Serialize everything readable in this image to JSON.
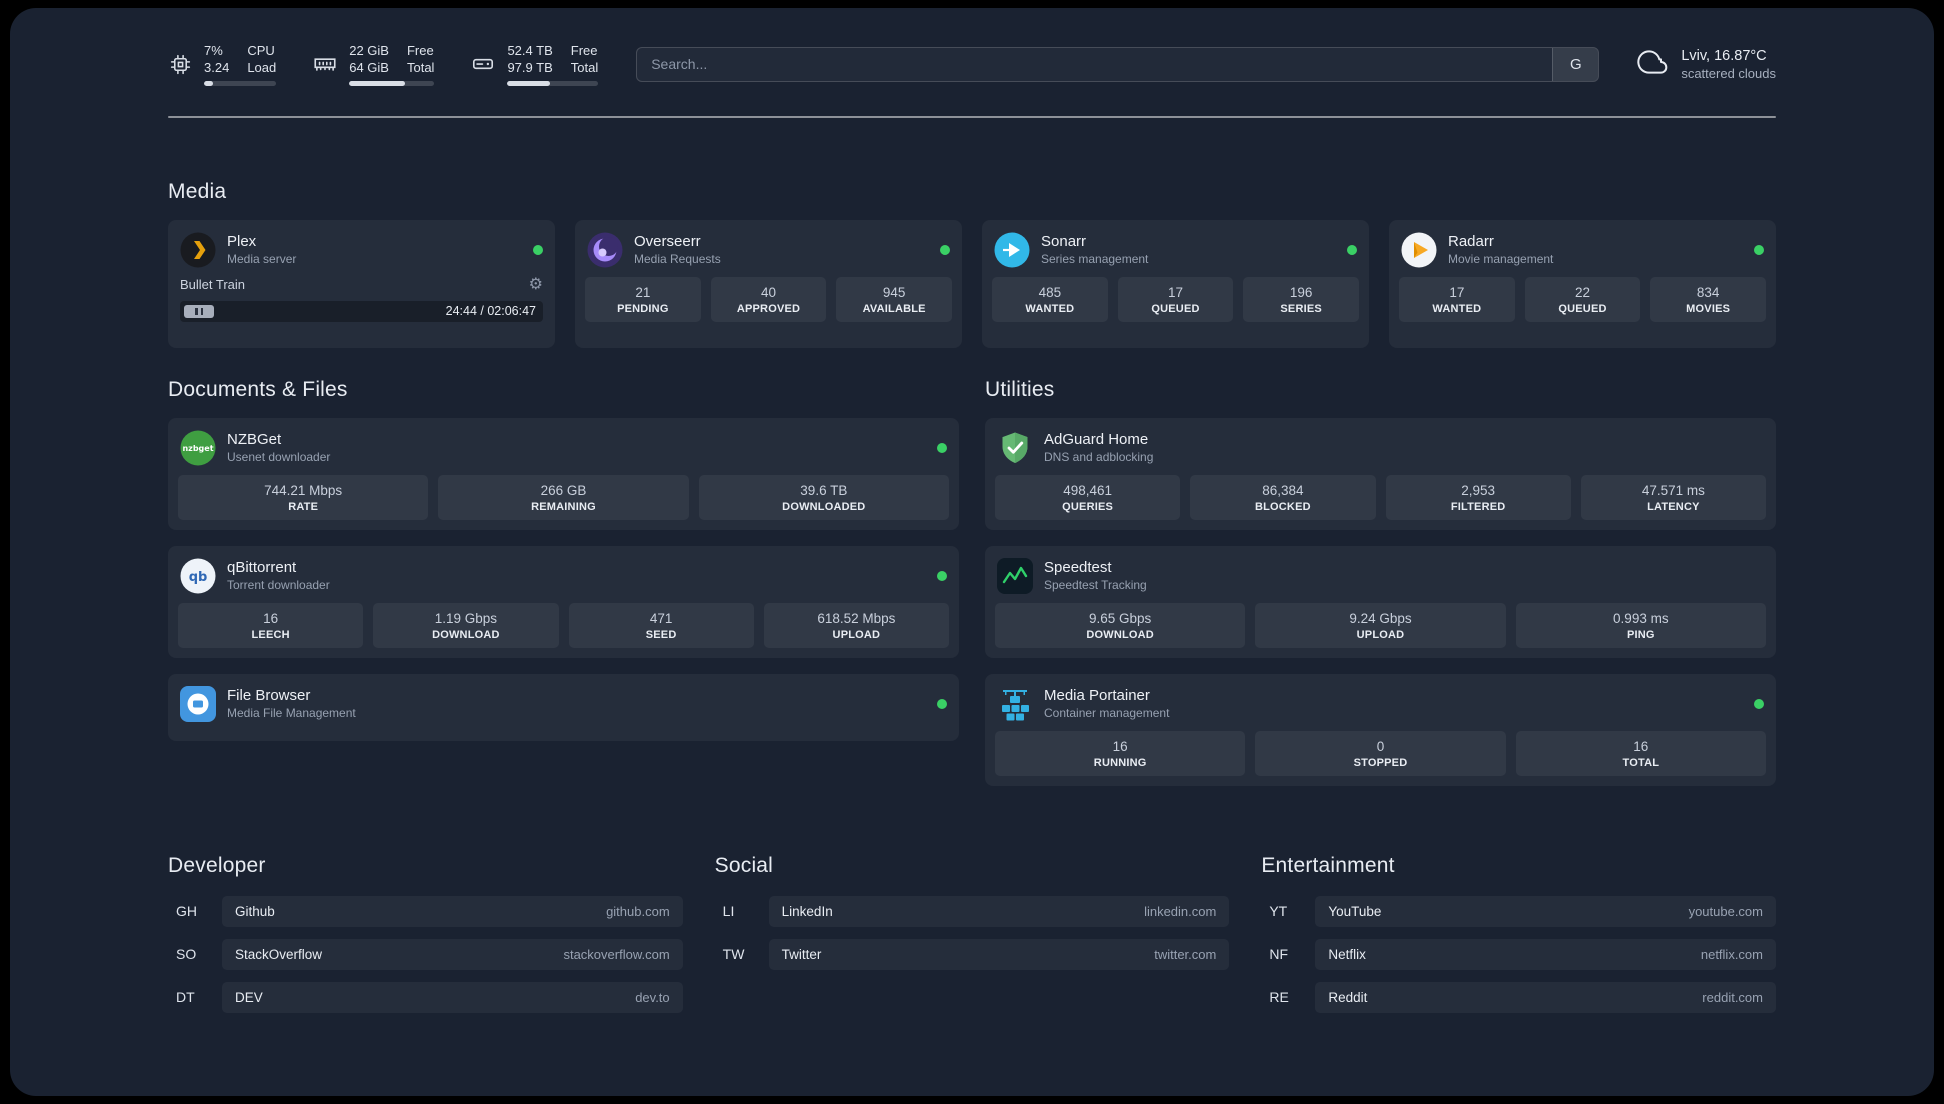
{
  "colors": {
    "background": "#1a2231",
    "card": "rgba(255,255,255,0.05)",
    "status_online": "#3ad065"
  },
  "topbar": {
    "resources": [
      {
        "id": "cpu",
        "rows_left": [
          "7%",
          "3.24"
        ],
        "rows_right": [
          "CPU",
          "Load"
        ],
        "bar_percent": 12
      },
      {
        "id": "memory",
        "rows_left": [
          "22 GiB",
          "64 GiB"
        ],
        "rows_right": [
          "Free",
          "Total"
        ],
        "bar_percent": 66
      },
      {
        "id": "disk",
        "rows_left": [
          "52.4 TB",
          "97.9 TB"
        ],
        "rows_right": [
          "Free",
          "Total"
        ],
        "bar_percent": 47
      }
    ],
    "search": {
      "placeholder": "Search...",
      "provider_button": "G"
    },
    "weather": {
      "location": "Lviv, 16.87°C",
      "condition": "scattered clouds"
    }
  },
  "sections": {
    "media": {
      "title": "Media",
      "cards": [
        {
          "name": "Plex",
          "subtitle": "Media server",
          "icon": "plex",
          "online": true,
          "player": {
            "track": "Bullet Train",
            "time": "24:44 / 02:06:47"
          }
        },
        {
          "name": "Overseerr",
          "subtitle": "Media Requests",
          "icon": "overseerr",
          "online": true,
          "stats": [
            {
              "value": "21",
              "label": "PENDING"
            },
            {
              "value": "40",
              "label": "APPROVED"
            },
            {
              "value": "945",
              "label": "AVAILABLE"
            }
          ]
        },
        {
          "name": "Sonarr",
          "subtitle": "Series management",
          "icon": "sonarr",
          "online": true,
          "stats": [
            {
              "value": "485",
              "label": "WANTED"
            },
            {
              "value": "17",
              "label": "QUEUED"
            },
            {
              "value": "196",
              "label": "SERIES"
            }
          ]
        },
        {
          "name": "Radarr",
          "subtitle": "Movie management",
          "icon": "radarr",
          "online": true,
          "stats": [
            {
              "value": "17",
              "label": "WANTED"
            },
            {
              "value": "22",
              "label": "QUEUED"
            },
            {
              "value": "834",
              "label": "MOVIES"
            }
          ]
        }
      ]
    },
    "documents": {
      "title": "Documents & Files",
      "cards": [
        {
          "name": "NZBGet",
          "subtitle": "Usenet downloader",
          "icon": "nzbget",
          "online": true,
          "stats": [
            {
              "value": "744.21 Mbps",
              "label": "RATE"
            },
            {
              "value": "266 GB",
              "label": "REMAINING"
            },
            {
              "value": "39.6 TB",
              "label": "DOWNLOADED"
            }
          ]
        },
        {
          "name": "qBittorrent",
          "subtitle": "Torrent downloader",
          "icon": "qbittorrent",
          "online": true,
          "stats": [
            {
              "value": "16",
              "label": "LEECH"
            },
            {
              "value": "1.19 Gbps",
              "label": "DOWNLOAD"
            },
            {
              "value": "471",
              "label": "SEED"
            },
            {
              "value": "618.52 Mbps",
              "label": "UPLOAD"
            }
          ]
        },
        {
          "name": "File Browser",
          "subtitle": "Media File Management",
          "icon": "filebrowser",
          "online": true,
          "stats": []
        }
      ]
    },
    "utilities": {
      "title": "Utilities",
      "cards": [
        {
          "name": "AdGuard Home",
          "subtitle": "DNS and adblocking",
          "icon": "adguard",
          "online": false,
          "stats": [
            {
              "value": "498,461",
              "label": "QUERIES"
            },
            {
              "value": "86,384",
              "label": "BLOCKED"
            },
            {
              "value": "2,953",
              "label": "FILTERED"
            },
            {
              "value": "47.571 ms",
              "label": "LATENCY"
            }
          ]
        },
        {
          "name": "Speedtest",
          "subtitle": "Speedtest Tracking",
          "icon": "speedtest",
          "online": false,
          "stats": [
            {
              "value": "9.65 Gbps",
              "label": "DOWNLOAD"
            },
            {
              "value": "9.24 Gbps",
              "label": "UPLOAD"
            },
            {
              "value": "0.993 ms",
              "label": "PING"
            }
          ]
        },
        {
          "name": "Media Portainer",
          "subtitle": "Container management",
          "icon": "portainer",
          "online": true,
          "stats": [
            {
              "value": "16",
              "label": "RUNNING"
            },
            {
              "value": "0",
              "label": "STOPPED"
            },
            {
              "value": "16",
              "label": "TOTAL"
            }
          ]
        }
      ]
    }
  },
  "bookmarks": {
    "groups": [
      {
        "title": "Developer",
        "items": [
          {
            "abbr": "GH",
            "name": "Github",
            "url": "github.com"
          },
          {
            "abbr": "SO",
            "name": "StackOverflow",
            "url": "stackoverflow.com"
          },
          {
            "abbr": "DT",
            "name": "DEV",
            "url": "dev.to"
          }
        ]
      },
      {
        "title": "Social",
        "items": [
          {
            "abbr": "LI",
            "name": "LinkedIn",
            "url": "linkedin.com"
          },
          {
            "abbr": "TW",
            "name": "Twitter",
            "url": "twitter.com"
          }
        ]
      },
      {
        "title": "Entertainment",
        "items": [
          {
            "abbr": "YT",
            "name": "YouTube",
            "url": "youtube.com"
          },
          {
            "abbr": "NF",
            "name": "Netflix",
            "url": "netflix.com"
          },
          {
            "abbr": "RE",
            "name": "Reddit",
            "url": "reddit.com"
          }
        ]
      }
    ]
  }
}
